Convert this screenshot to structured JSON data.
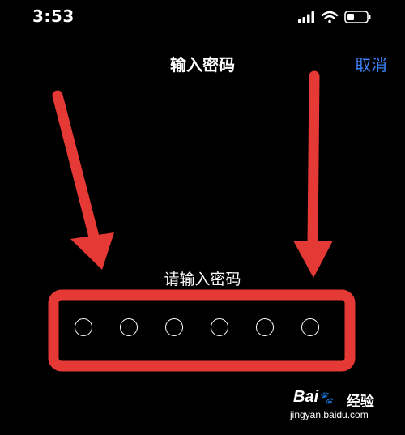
{
  "status_bar": {
    "time": "3:53",
    "icons": [
      "cellular-signal-icon",
      "wifi-icon",
      "battery-icon"
    ]
  },
  "nav": {
    "title": "输入密码",
    "cancel_label": "取消"
  },
  "passcode": {
    "prompt": "请输入密码",
    "digit_count": 6,
    "filled_count": 0
  },
  "annotation": {
    "color": "#e53935"
  },
  "watermark": {
    "brand": "Bai",
    "brand_suffix": "经验",
    "url": "jingyan.baidu.com"
  },
  "colors": {
    "background": "#000000",
    "accent": "#3d7ff5",
    "text": "#ffffff"
  }
}
